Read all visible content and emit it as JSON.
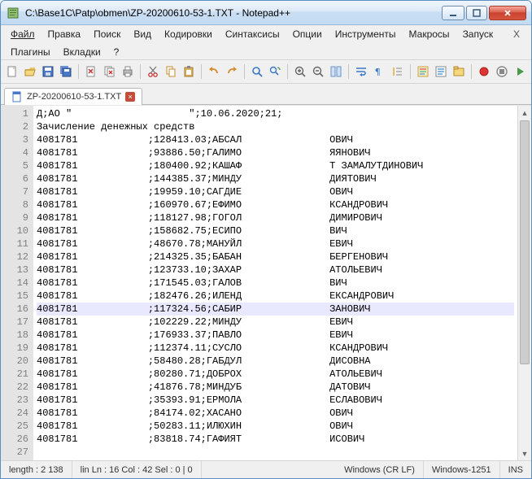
{
  "title": "C:\\Base1C\\Patp\\obmen\\ZP-20200610-53-1.TXT - Notepad++",
  "menu": [
    "Файл",
    "Правка",
    "Поиск",
    "Вид",
    "Кодировки",
    "Синтаксисы",
    "Опции",
    "Инструменты",
    "Макросы",
    "Запуск",
    "Плагины",
    "Вкладки",
    "?"
  ],
  "tab": {
    "label": "ZP-20200610-53-1.TXT"
  },
  "highlight_line": 16,
  "lines": [
    {
      "n": 1,
      "a": "Д;АО \"",
      "b": "                    ",
      "c": "\";10.06.2020;21;",
      "d": "",
      "e": ""
    },
    {
      "n": 2,
      "a": "Зачисление денежных средств",
      "b": "",
      "c": "",
      "d": "",
      "e": ""
    },
    {
      "n": 3,
      "a": "4081781",
      "b": "            ",
      "c": ";128413.03;АБСАЛ",
      "d": "               ",
      "e": "ОВИЧ"
    },
    {
      "n": 4,
      "a": "4081781",
      "b": "            ",
      "c": ";93886.50;ГАЛИМО",
      "d": "               ",
      "e": "ЯЯНОВИЧ"
    },
    {
      "n": 5,
      "a": "4081781",
      "b": "            ",
      "c": ";180400.92;КАШАФ",
      "d": "               ",
      "e": "Т ЗАМАЛУТДИНОВИЧ"
    },
    {
      "n": 6,
      "a": "4081781",
      "b": "            ",
      "c": ";144385.37;МИНДУ",
      "d": "               ",
      "e": "ДИЯТОВИЧ"
    },
    {
      "n": 7,
      "a": "4081781",
      "b": "            ",
      "c": ";19959.10;САГДИЕ",
      "d": "               ",
      "e": "ОВИЧ"
    },
    {
      "n": 8,
      "a": "4081781",
      "b": "            ",
      "c": ";160970.67;ЕФИМО",
      "d": "               ",
      "e": "КСАНДРОВИЧ"
    },
    {
      "n": 9,
      "a": "4081781",
      "b": "            ",
      "c": ";118127.98;ГОГОЛ",
      "d": "               ",
      "e": "ДИМИРОВИЧ"
    },
    {
      "n": 10,
      "a": "4081781",
      "b": "            ",
      "c": ";158682.75;ЕСИПО",
      "d": "               ",
      "e": "ВИЧ"
    },
    {
      "n": 11,
      "a": "4081781",
      "b": "            ",
      "c": ";48670.78;МАНУЙЛ",
      "d": "               ",
      "e": "ЕВИЧ"
    },
    {
      "n": 12,
      "a": "4081781",
      "b": "            ",
      "c": ";214325.35;БАБАН",
      "d": "               ",
      "e": "БЕРГЕНОВИЧ"
    },
    {
      "n": 13,
      "a": "4081781",
      "b": "            ",
      "c": ";123733.10;ЗАХАР",
      "d": "               ",
      "e": "АТОЛЬЕВИЧ"
    },
    {
      "n": 14,
      "a": "4081781",
      "b": "            ",
      "c": ";171545.03;ГАЛОВ",
      "d": "               ",
      "e": "ВИЧ"
    },
    {
      "n": 15,
      "a": "4081781",
      "b": "            ",
      "c": ";182476.26;ИЛЕНД",
      "d": "               ",
      "e": "ЕКСАНДРОВИЧ"
    },
    {
      "n": 16,
      "a": "4081781",
      "b": "            ",
      "c": ";117324.56;САБИР",
      "d": "               ",
      "e": "ЗАНОВИЧ"
    },
    {
      "n": 17,
      "a": "4081781",
      "b": "            ",
      "c": ";102229.22;МИНДУ",
      "d": "               ",
      "e": "ЕВИЧ"
    },
    {
      "n": 18,
      "a": "4081781",
      "b": "            ",
      "c": ";176933.37;ПАВЛО",
      "d": "               ",
      "e": "ЕВИЧ"
    },
    {
      "n": 19,
      "a": "4081781",
      "b": "            ",
      "c": ";112374.11;СУСЛО",
      "d": "               ",
      "e": "КСАНДРОВИЧ"
    },
    {
      "n": 20,
      "a": "4081781",
      "b": "            ",
      "c": ";58480.28;ГАБДУЛ",
      "d": "               ",
      "e": "ДИСОВНА"
    },
    {
      "n": 21,
      "a": "4081781",
      "b": "            ",
      "c": ";80280.71;ДОБРОХ",
      "d": "               ",
      "e": "АТОЛЬЕВИЧ"
    },
    {
      "n": 22,
      "a": "4081781",
      "b": "            ",
      "c": ";41876.78;МИНДУБ",
      "d": "               ",
      "e": "ДАТОВИЧ"
    },
    {
      "n": 23,
      "a": "4081781",
      "b": "            ",
      "c": ";35393.91;ЕРМОЛА",
      "d": "               ",
      "e": "ЕСЛАВОВИЧ"
    },
    {
      "n": 24,
      "a": "4081781",
      "b": "            ",
      "c": ";84174.02;ХАСАНО",
      "d": "               ",
      "e": "ОВИЧ"
    },
    {
      "n": 25,
      "a": "4081781",
      "b": "            ",
      "c": ";50283.11;ИЛЮХИН",
      "d": "               ",
      "e": "ОВИЧ"
    },
    {
      "n": 26,
      "a": "4081781",
      "b": "            ",
      "c": ";83818.74;ГАФИЯТ",
      "d": "               ",
      "e": "ИСОВИЧ"
    },
    {
      "n": 27,
      "a": "",
      "b": "",
      "c": "",
      "d": "",
      "e": ""
    }
  ],
  "status": {
    "length": "length : 2 138",
    "pos": "lin  Ln : 16    Col : 42    Sel : 0 | 0",
    "eol": "Windows (CR LF)",
    "enc": "Windows-1251",
    "mode": "INS"
  }
}
